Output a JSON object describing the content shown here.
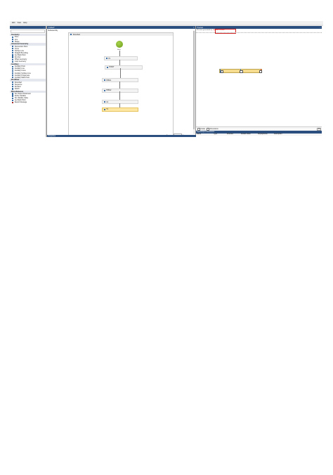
{
  "menu": [
    "Edit",
    "View",
    "Help"
  ],
  "toolbox": {
    "title": "... ",
    "categories": [
      {
        "name": "Geometry",
        "items": [
          "Point",
          "Line",
          "Shape"
        ]
      },
      {
        "name": "Advanced Geometry",
        "items": [
          "Intersection Point",
          "Curve",
          "Surface Line",
          "Straight Bounding",
          "Get Mark Point",
          "Find Arc",
          "Offset Geometry",
          "Loop Geometry"
        ]
      },
      {
        "name": "Auxiliary",
        "items": [
          "Auxiliary Point",
          "Auxiliary Line",
          "Auxiliary Curve",
          "Auxiliary Surface Line",
          "Auxiliary Polyarrows",
          "Auxiliary Mark Point"
        ]
      },
      {
        "name": "Workflow",
        "items": [
          "Flowchart",
          "Sequence",
          "Decision",
          "Switch"
        ]
      },
      {
        "name": "Miscellaneous",
        "items": [
          "Set Output Parameter",
          "Define Variable",
          "Set Variable Value",
          "Get Mark Point",
          "Report Message"
        ]
      }
    ]
  },
  "designer": {
    "tab": "Untitled*",
    "breadcrumb": "Subassembly",
    "flowchart_label": "Flowchart",
    "start_label": "Start",
    "nodes": [
      "P1",
      "POINT",
      "P2BL1",
      "P2BL2",
      "C1",
      "T1"
    ],
    "properties_label": "Properties"
  },
  "preview": {
    "title": "Preview",
    "hint": "Preview generated by",
    "hint_link": "Update Preview",
    "checks": [
      "Codes",
      "Dimensions"
    ],
    "fit_label": "Fit"
  },
  "io": {
    "title": "Input/Output Parameters",
    "columns": [
      "Name",
      "Type",
      "Direction",
      "Default Value",
      "DisplayName",
      "Description"
    ]
  }
}
